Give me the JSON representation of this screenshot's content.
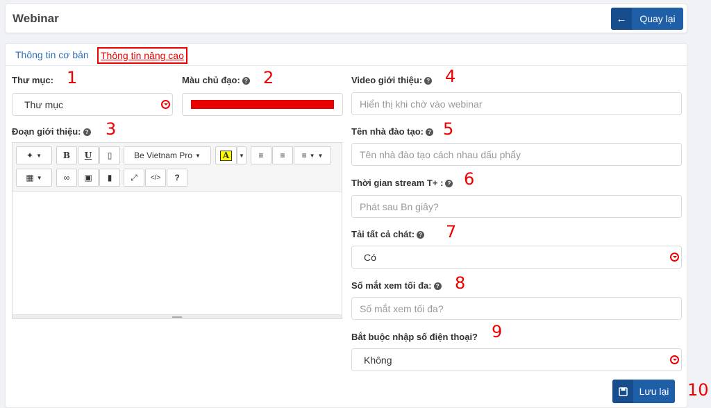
{
  "header": {
    "title": "Webinar",
    "back_label": "Quay lại"
  },
  "tabs": [
    {
      "label": "Thông tin cơ bản"
    },
    {
      "label": "Thông tin nâng cao"
    }
  ],
  "left": {
    "folder": {
      "label": "Thư mục:",
      "value": "Thư mục",
      "marker": "1"
    },
    "color": {
      "label": "Màu chủ đạo:",
      "value": "#e60000",
      "marker": "2"
    },
    "intro": {
      "label": "Đoạn giới thiệu:",
      "marker": "3",
      "font": "Be Vietnam Pro"
    }
  },
  "right": {
    "video": {
      "label": "Video giới thiệu:",
      "placeholder": "Hiển thị khi chờ vào webinar",
      "marker": "4"
    },
    "trainer": {
      "label": "Tên nhà đào tạo:",
      "placeholder": "Tên nhà đào tạo cách nhau dấu phẩy",
      "marker": "5"
    },
    "stream": {
      "label": "Thời gian stream T+ :",
      "placeholder": "Phát sau Bn giây?",
      "marker": "6"
    },
    "chat": {
      "label": "Tải tất cả chát:",
      "value": "Có",
      "marker": "7"
    },
    "viewers": {
      "label": "Số mắt xem tối đa:",
      "placeholder": "Số mắt xem tối đa?",
      "marker": "8"
    },
    "phone": {
      "label": "Bắt buộc nhập số điện thoại?",
      "value": "Không",
      "marker": "9"
    }
  },
  "save": {
    "label": "Lưu lại",
    "marker": "10"
  },
  "colors": {
    "primary": "#1f5fa8",
    "annotation": "#e00000",
    "tab_link": "#2c6fb8"
  }
}
